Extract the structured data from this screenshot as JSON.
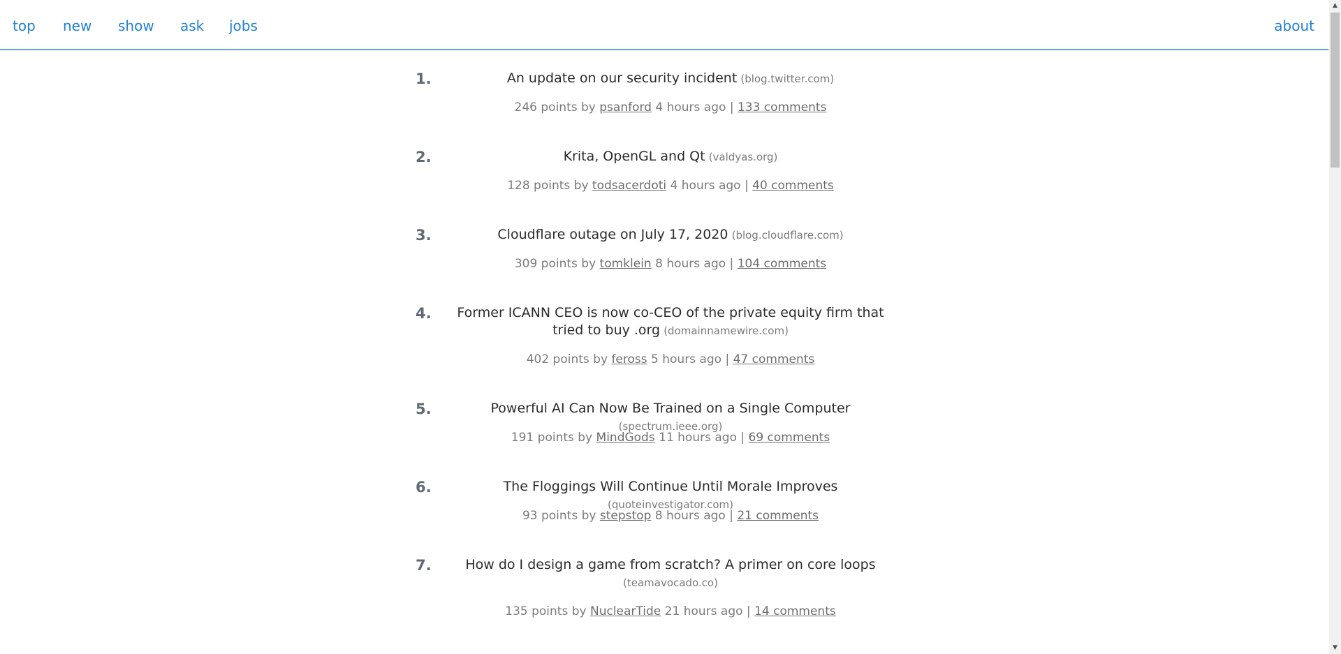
{
  "nav": {
    "top": "top",
    "new": "new",
    "show": "show",
    "ask": "ask",
    "jobs": "jobs",
    "about": "about"
  },
  "stories": [
    {
      "rank": "1.",
      "title": "An update on our security incident",
      "domain": "(blog.twitter.com)",
      "points": "246 points by",
      "user": "psanford",
      "age": "4 hours ago |",
      "comments": "133 comments"
    },
    {
      "rank": "2.",
      "title": "Krita, OpenGL and Qt",
      "domain": "(valdyas.org)",
      "points": "128 points by",
      "user": "todsacerdoti",
      "age": "4 hours ago |",
      "comments": "40 comments"
    },
    {
      "rank": "3.",
      "title": "Cloudflare outage on July 17, 2020",
      "domain": "(blog.cloudflare.com)",
      "points": "309 points by",
      "user": "tomklein",
      "age": "8 hours ago |",
      "comments": "104 comments"
    },
    {
      "rank": "4.",
      "title": "Former ICANN CEO is now co-CEO of the private equity firm that tried to buy .org",
      "domain": "(domainnamewire.com)",
      "points": "402 points by",
      "user": "feross",
      "age": "5 hours ago |",
      "comments": "47 comments"
    },
    {
      "rank": "5.",
      "title": "Powerful AI Can Now Be Trained on a Single Computer",
      "domain": "(spectrum.ieee.org)",
      "points": "191 points by",
      "user": "MindGods",
      "age": "11 hours ago |",
      "comments": "69 comments"
    },
    {
      "rank": "6.",
      "title": "The Floggings Will Continue Until Morale Improves",
      "domain": "(quoteinvestigator.com)",
      "points": "93 points by",
      "user": "stepstop",
      "age": "8 hours ago |",
      "comments": "21 comments"
    },
    {
      "rank": "7.",
      "title": "How do I design a game from scratch? A primer on core loops",
      "domain": "(teamavocado.co)",
      "points": "135 points by",
      "user": "NuclearTide",
      "age": "21 hours ago |",
      "comments": "14 comments"
    }
  ],
  "colors": {
    "nav_link": "#1f7fd6",
    "nav_border": "#5aa3e8",
    "title": "#2b2b2b",
    "meta": "#7a7a7a",
    "rank": "#5f6a75"
  }
}
